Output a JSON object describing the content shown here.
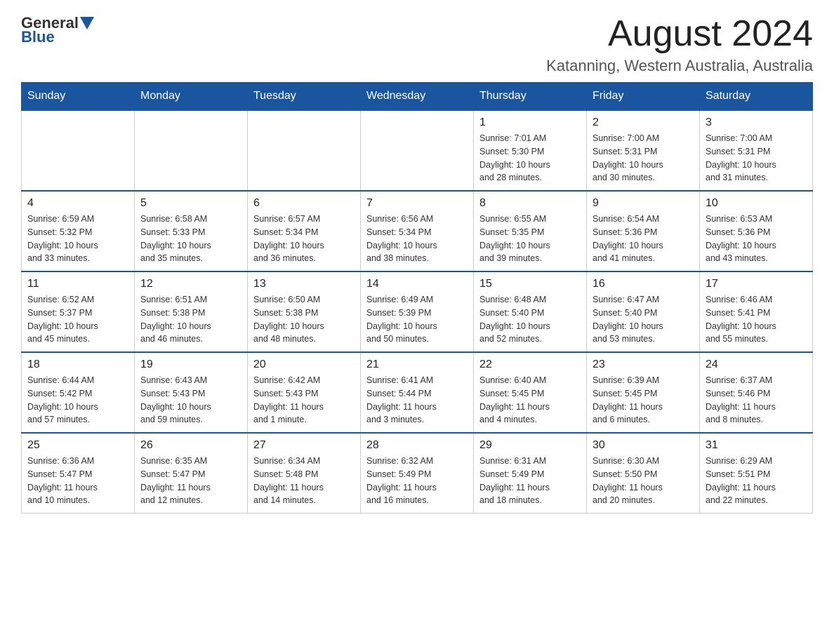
{
  "header": {
    "logo_general": "General",
    "logo_blue": "Blue",
    "month_title": "August 2024",
    "location": "Katanning, Western Australia, Australia"
  },
  "days_of_week": [
    "Sunday",
    "Monday",
    "Tuesday",
    "Wednesday",
    "Thursday",
    "Friday",
    "Saturday"
  ],
  "weeks": [
    [
      {
        "day": "",
        "info": ""
      },
      {
        "day": "",
        "info": ""
      },
      {
        "day": "",
        "info": ""
      },
      {
        "day": "",
        "info": ""
      },
      {
        "day": "1",
        "info": "Sunrise: 7:01 AM\nSunset: 5:30 PM\nDaylight: 10 hours\nand 28 minutes."
      },
      {
        "day": "2",
        "info": "Sunrise: 7:00 AM\nSunset: 5:31 PM\nDaylight: 10 hours\nand 30 minutes."
      },
      {
        "day": "3",
        "info": "Sunrise: 7:00 AM\nSunset: 5:31 PM\nDaylight: 10 hours\nand 31 minutes."
      }
    ],
    [
      {
        "day": "4",
        "info": "Sunrise: 6:59 AM\nSunset: 5:32 PM\nDaylight: 10 hours\nand 33 minutes."
      },
      {
        "day": "5",
        "info": "Sunrise: 6:58 AM\nSunset: 5:33 PM\nDaylight: 10 hours\nand 35 minutes."
      },
      {
        "day": "6",
        "info": "Sunrise: 6:57 AM\nSunset: 5:34 PM\nDaylight: 10 hours\nand 36 minutes."
      },
      {
        "day": "7",
        "info": "Sunrise: 6:56 AM\nSunset: 5:34 PM\nDaylight: 10 hours\nand 38 minutes."
      },
      {
        "day": "8",
        "info": "Sunrise: 6:55 AM\nSunset: 5:35 PM\nDaylight: 10 hours\nand 39 minutes."
      },
      {
        "day": "9",
        "info": "Sunrise: 6:54 AM\nSunset: 5:36 PM\nDaylight: 10 hours\nand 41 minutes."
      },
      {
        "day": "10",
        "info": "Sunrise: 6:53 AM\nSunset: 5:36 PM\nDaylight: 10 hours\nand 43 minutes."
      }
    ],
    [
      {
        "day": "11",
        "info": "Sunrise: 6:52 AM\nSunset: 5:37 PM\nDaylight: 10 hours\nand 45 minutes."
      },
      {
        "day": "12",
        "info": "Sunrise: 6:51 AM\nSunset: 5:38 PM\nDaylight: 10 hours\nand 46 minutes."
      },
      {
        "day": "13",
        "info": "Sunrise: 6:50 AM\nSunset: 5:38 PM\nDaylight: 10 hours\nand 48 minutes."
      },
      {
        "day": "14",
        "info": "Sunrise: 6:49 AM\nSunset: 5:39 PM\nDaylight: 10 hours\nand 50 minutes."
      },
      {
        "day": "15",
        "info": "Sunrise: 6:48 AM\nSunset: 5:40 PM\nDaylight: 10 hours\nand 52 minutes."
      },
      {
        "day": "16",
        "info": "Sunrise: 6:47 AM\nSunset: 5:40 PM\nDaylight: 10 hours\nand 53 minutes."
      },
      {
        "day": "17",
        "info": "Sunrise: 6:46 AM\nSunset: 5:41 PM\nDaylight: 10 hours\nand 55 minutes."
      }
    ],
    [
      {
        "day": "18",
        "info": "Sunrise: 6:44 AM\nSunset: 5:42 PM\nDaylight: 10 hours\nand 57 minutes."
      },
      {
        "day": "19",
        "info": "Sunrise: 6:43 AM\nSunset: 5:43 PM\nDaylight: 10 hours\nand 59 minutes."
      },
      {
        "day": "20",
        "info": "Sunrise: 6:42 AM\nSunset: 5:43 PM\nDaylight: 11 hours\nand 1 minute."
      },
      {
        "day": "21",
        "info": "Sunrise: 6:41 AM\nSunset: 5:44 PM\nDaylight: 11 hours\nand 3 minutes."
      },
      {
        "day": "22",
        "info": "Sunrise: 6:40 AM\nSunset: 5:45 PM\nDaylight: 11 hours\nand 4 minutes."
      },
      {
        "day": "23",
        "info": "Sunrise: 6:39 AM\nSunset: 5:45 PM\nDaylight: 11 hours\nand 6 minutes."
      },
      {
        "day": "24",
        "info": "Sunrise: 6:37 AM\nSunset: 5:46 PM\nDaylight: 11 hours\nand 8 minutes."
      }
    ],
    [
      {
        "day": "25",
        "info": "Sunrise: 6:36 AM\nSunset: 5:47 PM\nDaylight: 11 hours\nand 10 minutes."
      },
      {
        "day": "26",
        "info": "Sunrise: 6:35 AM\nSunset: 5:47 PM\nDaylight: 11 hours\nand 12 minutes."
      },
      {
        "day": "27",
        "info": "Sunrise: 6:34 AM\nSunset: 5:48 PM\nDaylight: 11 hours\nand 14 minutes."
      },
      {
        "day": "28",
        "info": "Sunrise: 6:32 AM\nSunset: 5:49 PM\nDaylight: 11 hours\nand 16 minutes."
      },
      {
        "day": "29",
        "info": "Sunrise: 6:31 AM\nSunset: 5:49 PM\nDaylight: 11 hours\nand 18 minutes."
      },
      {
        "day": "30",
        "info": "Sunrise: 6:30 AM\nSunset: 5:50 PM\nDaylight: 11 hours\nand 20 minutes."
      },
      {
        "day": "31",
        "info": "Sunrise: 6:29 AM\nSunset: 5:51 PM\nDaylight: 11 hours\nand 22 minutes."
      }
    ]
  ]
}
